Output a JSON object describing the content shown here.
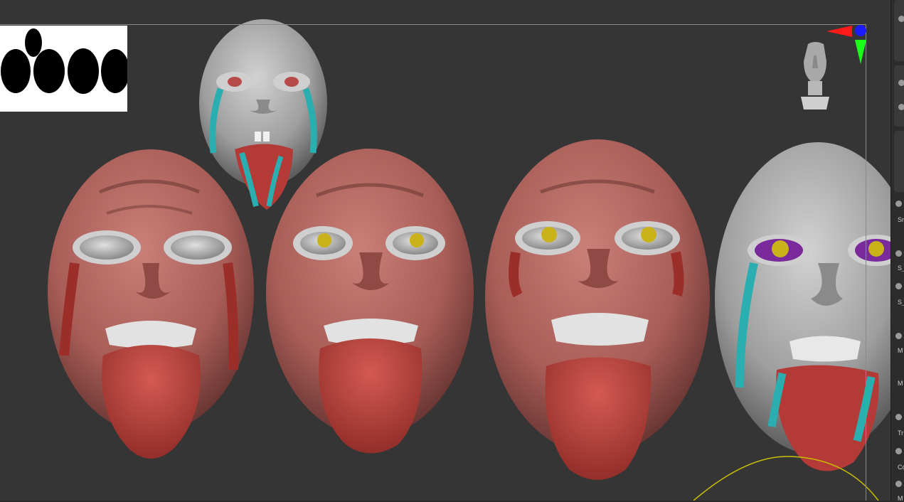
{
  "app": {
    "name": "ZBrush viewport"
  },
  "viewport": {
    "background": "#353535",
    "skin_color": "#b56a63",
    "gray_color": "#a8a8a8",
    "tongue_color": "#b8403b",
    "tear_color": "#2aaeb0",
    "eye_yellow": "#c9b21a",
    "eye_purple": "#7a2a9a"
  },
  "thumbnail": {
    "icon": "silhouette-thumbnail"
  },
  "gizmo": {
    "icon": "axis-gizmo-icon",
    "colors": {
      "x": "#ff1a1a",
      "y": "#1aff1a",
      "z": "#1a1aff"
    }
  },
  "navigator": {
    "icon": "head-navigator-icon"
  },
  "right_panel": {
    "labels": [
      "Sn",
      "S_",
      "S_",
      "M",
      "M",
      "Tr",
      "Cc",
      "M"
    ]
  }
}
